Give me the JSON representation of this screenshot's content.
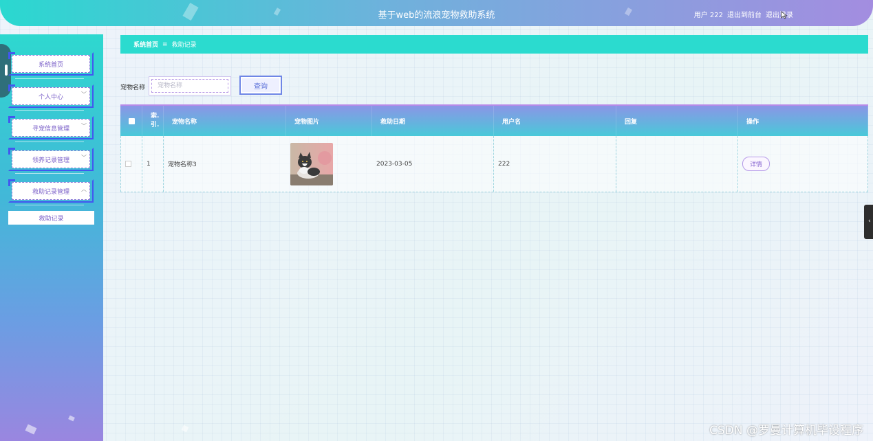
{
  "header": {
    "title": "基于web的流浪宠物救助系统",
    "user": "用户 222",
    "exit_front": "退出到前台",
    "logout": "退出登录"
  },
  "sidebar": {
    "items": [
      {
        "label": "系统首页"
      },
      {
        "label": "个人中心"
      },
      {
        "label": "寻宠信息管理"
      },
      {
        "label": "领养记录管理"
      },
      {
        "label": "救助记录管理"
      }
    ],
    "submenu": "救助记录"
  },
  "breadcrumb": {
    "home": "系统首页",
    "separator": "≡",
    "current": "救助记录"
  },
  "search": {
    "label": "宠物名称",
    "placeholder": "宠物名称",
    "button": "查询"
  },
  "table": {
    "headers": [
      "索引",
      "宠物名称",
      "宠物图片",
      "救助日期",
      "用户名",
      "回复",
      "操作"
    ],
    "index_header_line1": "索.",
    "index_header_line2": "引.",
    "rows": [
      {
        "index": "1",
        "pet_name": "宠物名称3",
        "rescue_date": "2023-03-05",
        "username": "222",
        "reply": "",
        "action": "详情"
      }
    ]
  },
  "watermark": "CSDN @罗曼计算机毕设程序"
}
